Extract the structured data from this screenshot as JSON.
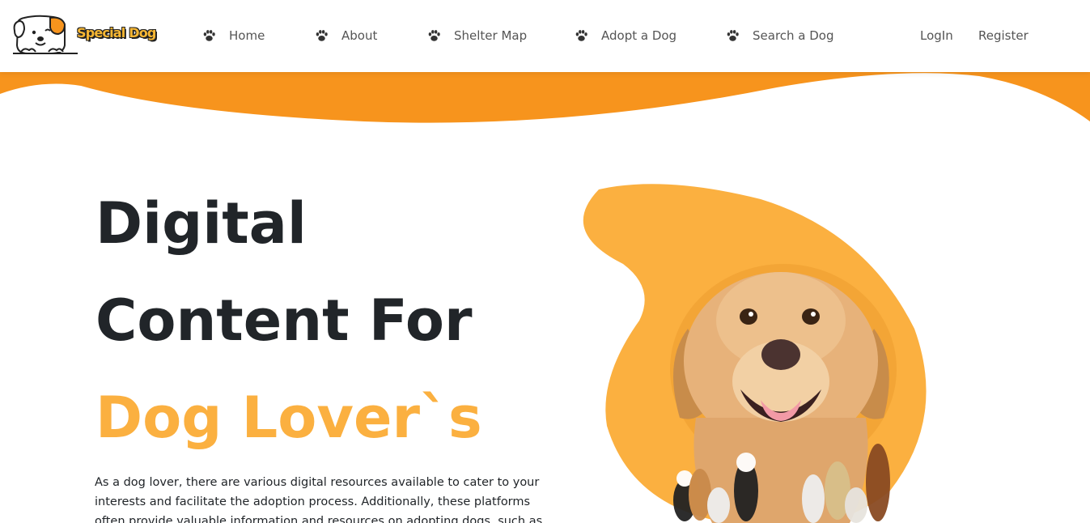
{
  "brand": {
    "name": "Special Dog"
  },
  "nav": {
    "items": [
      {
        "label": "Home",
        "icon": "paw-icon"
      },
      {
        "label": "About",
        "icon": "paw-icon"
      },
      {
        "label": "Shelter Map",
        "icon": "paw-icon"
      },
      {
        "label": "Adopt a Dog",
        "icon": "paw-icon"
      },
      {
        "label": "Search a Dog",
        "icon": "paw-icon"
      }
    ],
    "login": "LogIn",
    "register": "Register"
  },
  "hero": {
    "line1": "Digital",
    "line2": "Content For",
    "line3": "Dog Lover`s",
    "description": "As a dog lover, there are various digital resources available to cater to your interests and facilitate the adoption process. Additionally, these platforms often provide valuable information and resources on adopting dogs, such as"
  },
  "colors": {
    "accent": "#fbb040",
    "wave": "#f7941d",
    "text": "#212529",
    "nav_text": "#555555"
  }
}
